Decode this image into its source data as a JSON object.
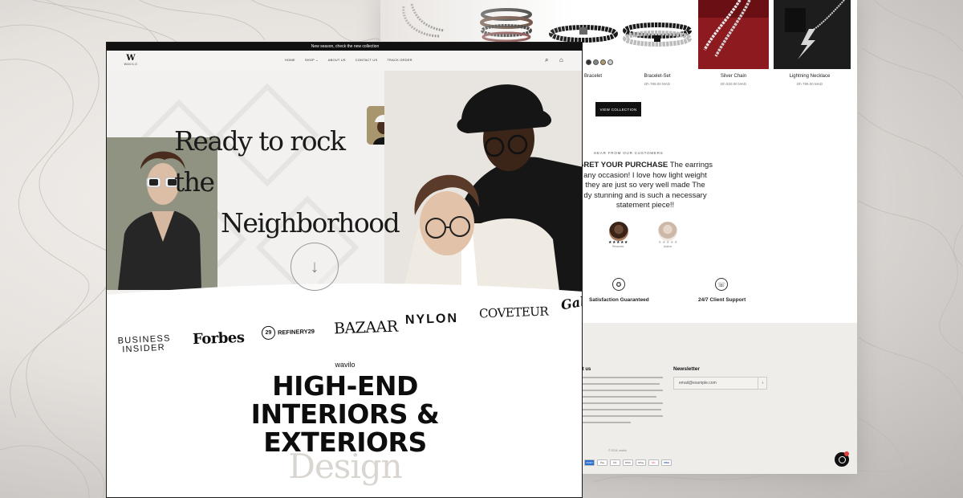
{
  "back_window": {
    "products": [
      {
        "name": "",
        "price": "",
        "image": "beaded-necklace"
      },
      {
        "name": "",
        "price": "",
        "image": "leather-bracelet-stack"
      },
      {
        "name": "Bracelet",
        "price": "",
        "image": "black-bead-bracelet"
      },
      {
        "name": "Bracelet-Set",
        "price": "Dh 789.00 MAD",
        "image": "bead-bracelet-set"
      },
      {
        "name": "Silver Chain",
        "price": "Dh 820.00 MAD",
        "image": "silver-chain-on-red"
      },
      {
        "name": "Lightning Necklace",
        "price": "Dh 795.00 MAD",
        "image": "lightning-pendant"
      }
    ],
    "view_collection_label": "VIEW COLLECTION",
    "reviews_heading": "HEAR FROM OUR CUSTOMERS",
    "review_text_bold": "GRET YOUR PURCHASE",
    "review_lines": [
      "The earrings",
      "any occasion! I love how light weight",
      "they are just so very well made The",
      "dy stunning and is such a necessary",
      "statement piece!!"
    ],
    "reviewers": [
      {
        "stars": "★★★★★",
        "name": "Reviewer"
      },
      {
        "stars": "★★★★★",
        "name": "Author"
      }
    ],
    "features": [
      {
        "label": "Satisfaction Guaranteed",
        "icon": "ribbon-icon"
      },
      {
        "label": "24/7 Client Support",
        "icon": "support-icon"
      }
    ],
    "footer": {
      "about_title": "ut us",
      "newsletter_title": "Newsletter",
      "email_placeholder": "email@example.com",
      "submit_glyph": "›",
      "copyright": "© 2024, wavilo",
      "payments": [
        "AMEX",
        "Pay",
        "GPay",
        "DC",
        "DISC",
        "MC",
        "VISA"
      ]
    }
  },
  "front_window": {
    "announcement": "New season, check the new collection",
    "logo_mark": "W",
    "logo_text": "WAVILO",
    "nav": [
      "HOME",
      "SHOP ⌄",
      "ABOUT US",
      "CONTACT US",
      "TRACK ORDER"
    ],
    "search_icon_glyph": "⌕",
    "cart_icon_glyph": "⌂",
    "hero_line1": "Ready to rock the",
    "hero_line2": "Neighborhood",
    "scroll_glyph": "↓",
    "brands": {
      "business_insider_1": "BUSINESS",
      "business_insider_2": "INSIDER",
      "forbes": "Forbes",
      "refinery_badge": "29",
      "refinery": "REFINERY29",
      "bazaar": "BAZAAR",
      "nylon": "NYLON",
      "coveteur": "COVETEUR",
      "gala": "Gal"
    },
    "brand_small": "wavilo",
    "headline_lines": [
      "HIGH-END",
      "INTERIORS &",
      "EXTERIORS"
    ],
    "design_word": "Design"
  },
  "colors": {
    "accent_dark": "#111111",
    "background": "#f4f3f1",
    "chat_badge": "#e03c3c"
  }
}
